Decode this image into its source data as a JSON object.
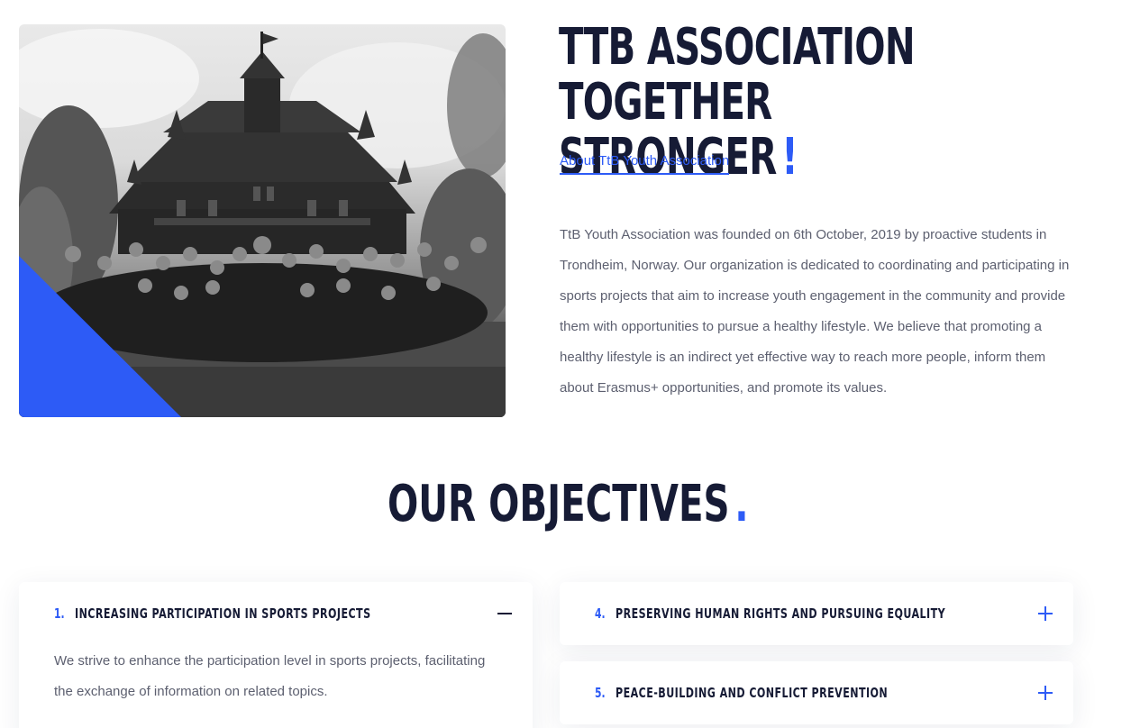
{
  "about": {
    "title_line1": "TtB Association Together",
    "title_line2": "Stronger",
    "title_accent": "!",
    "link_label": "About TtB Youth Association",
    "paragraph": "TtB Youth Association was founded on 6th October, 2019 by proactive students in Trondheim, Norway. Our organization is dedicated to coordinating and participating in sports projects that aim to increase youth engagement in the community and provide them with opportunities to pursue a healthy lifestyle. We believe that promoting a healthy lifestyle is an indirect yet effective way to reach more people, inform them about Erasmus+ opportunities, and promote its values."
  },
  "objectives": {
    "heading": "OUR OBJECTIVES",
    "heading_accent": ".",
    "items": [
      {
        "number": "1.",
        "title": "Increasing Participation in Sports Projects",
        "expanded": true,
        "body": "We strive to enhance the participation level in sports projects, facilitating the exchange of information on related topics."
      },
      {
        "number": "4.",
        "title": "Preserving Human Rights and Pursuing Equality",
        "expanded": false
      },
      {
        "number": "5.",
        "title": "Peace-Building and Conflict Prevention",
        "expanded": false
      }
    ]
  },
  "colors": {
    "accent": "#2d5bf6",
    "heading": "#161b35",
    "body_text": "#5d6070"
  },
  "icons": {
    "collapse": "minus-icon",
    "expand": "plus-icon"
  }
}
